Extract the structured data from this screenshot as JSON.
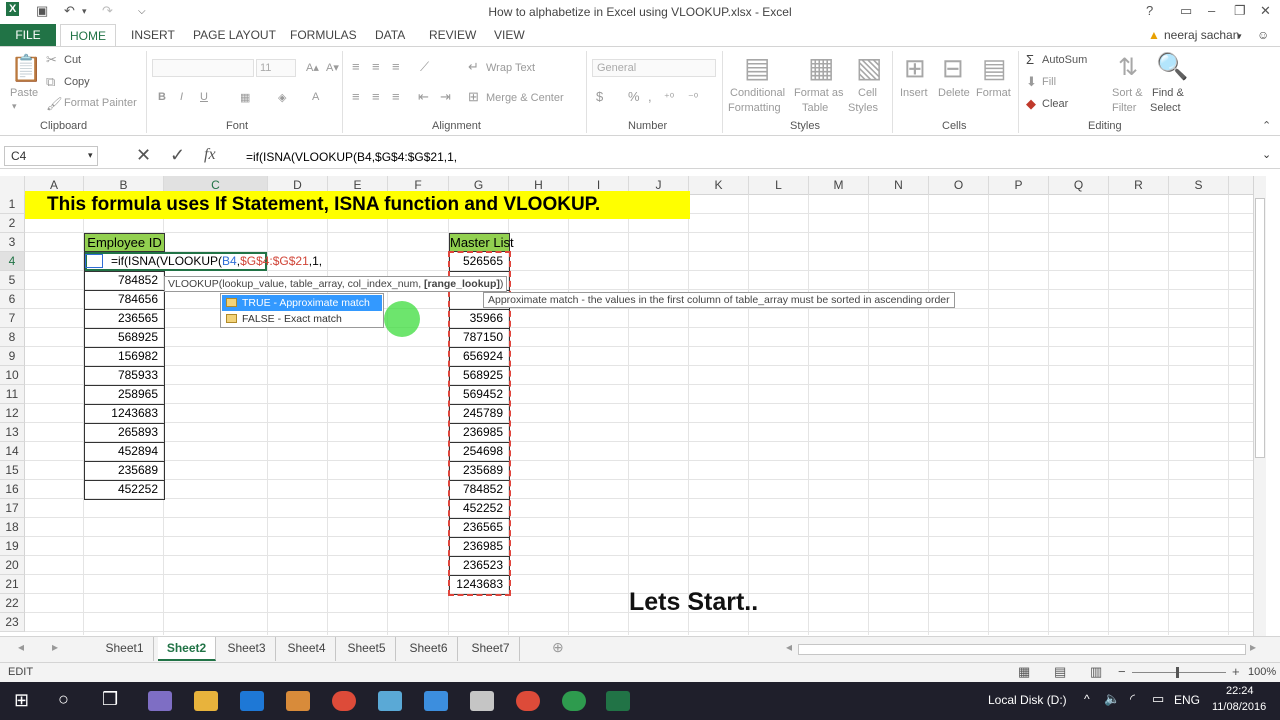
{
  "window": {
    "title": "How to alphabetize in Excel using VLOOKUP.xlsx - Excel",
    "user": "neeraj sachan",
    "user_warning_icon": "warning-icon"
  },
  "tabs": [
    "FILE",
    "HOME",
    "INSERT",
    "PAGE LAYOUT",
    "FORMULAS",
    "DATA",
    "REVIEW",
    "VIEW"
  ],
  "ribbon": {
    "clipboard": {
      "paste": "Paste",
      "cut": "Cut",
      "copy": "Copy",
      "format_painter": "Format Painter",
      "group": "Clipboard"
    },
    "font": {
      "size": "11",
      "bold": "B",
      "italic": "I",
      "underline": "U",
      "font_color": "A",
      "group": "Font"
    },
    "alignment": {
      "wrap": "Wrap Text",
      "merge": "Merge & Center",
      "group": "Alignment"
    },
    "number": {
      "format": "General",
      "group": "Number"
    },
    "styles": {
      "conditional": "Conditional",
      "conditional2": "Formatting",
      "format_as": "Format as",
      "table": "Table",
      "cell": "Cell",
      "styles_lbl": "Styles",
      "group": "Styles"
    },
    "cells": {
      "insert": "Insert",
      "delete": "Delete",
      "format": "Format",
      "group": "Cells"
    },
    "editing": {
      "autosum": "AutoSum",
      "fill": "Fill",
      "clear": "Clear",
      "sort": "Sort &",
      "filter": "Filter",
      "find": "Find &",
      "select": "Select",
      "group": "Editing"
    }
  },
  "formula_bar": {
    "name_box": "C4",
    "cancel": "✕",
    "enter": "✓",
    "fx": "fx",
    "formula": "=if(ISNA(VLOOKUP(B4,$G$4:$G$21,1,"
  },
  "columns": [
    "A",
    "B",
    "C",
    "D",
    "E",
    "F",
    "G",
    "H",
    "I",
    "J",
    "K",
    "L",
    "M",
    "N",
    "O",
    "P",
    "Q",
    "R",
    "S"
  ],
  "rows": [
    "1",
    "2",
    "3",
    "4",
    "5",
    "6",
    "7",
    "8",
    "9",
    "10",
    "11",
    "12",
    "13",
    "14",
    "15",
    "16",
    "17",
    "18",
    "19",
    "20",
    "21",
    "22",
    "23"
  ],
  "sheet": {
    "banner": "This formula uses If Statement, ISNA function and VLOOKUP.",
    "employee_header": "Employee ID",
    "master_header": "Master List",
    "editing_prefix": "=if(ISNA(",
    "editing_vlookup": "VLOOKUP(",
    "editing_b4": "B4",
    "editing_sep1": ",",
    "editing_range": "$G$4:$G$21",
    "editing_rest": ",1,",
    "employee_ids": [
      "784852",
      "784656",
      "236565",
      "568925",
      "156982",
      "785933",
      "258965",
      "1243683",
      "265893",
      "452894",
      "235689",
      "452252"
    ],
    "master_list": [
      "526565",
      "",
      "",
      "35966",
      "787150",
      "656924",
      "568925",
      "569452",
      "245789",
      "236985",
      "254698",
      "235689",
      "784852",
      "452252",
      "236565",
      "236985",
      "236523",
      "1243683"
    ],
    "footer_text": "Lets Start.."
  },
  "tooltip": {
    "text": "VLOOKUP(lookup_value, table_array, col_index_num, ",
    "bold": "[range_lookup]",
    "close": ")"
  },
  "autocomplete": {
    "options": [
      "TRUE - Approximate match",
      "FALSE - Exact match"
    ],
    "description": "Approximate match - the values in the first column of table_array must be sorted in ascending order"
  },
  "sheet_tabs": [
    "Sheet1",
    "Sheet2",
    "Sheet3",
    "Sheet4",
    "Sheet5",
    "Sheet6",
    "Sheet7"
  ],
  "active_sheet": "Sheet2",
  "status": {
    "mode": "EDIT",
    "zoom": "100%"
  },
  "taskbar": {
    "disk": "Local Disk (D:)",
    "lang": "ENG",
    "time": "22:24",
    "date": "11/08/2016"
  },
  "colors": {
    "excel_green": "#217346",
    "banner_bg": "#ffff00",
    "header_green": "#92d050",
    "tooltip_highlight": "#3399ff"
  }
}
